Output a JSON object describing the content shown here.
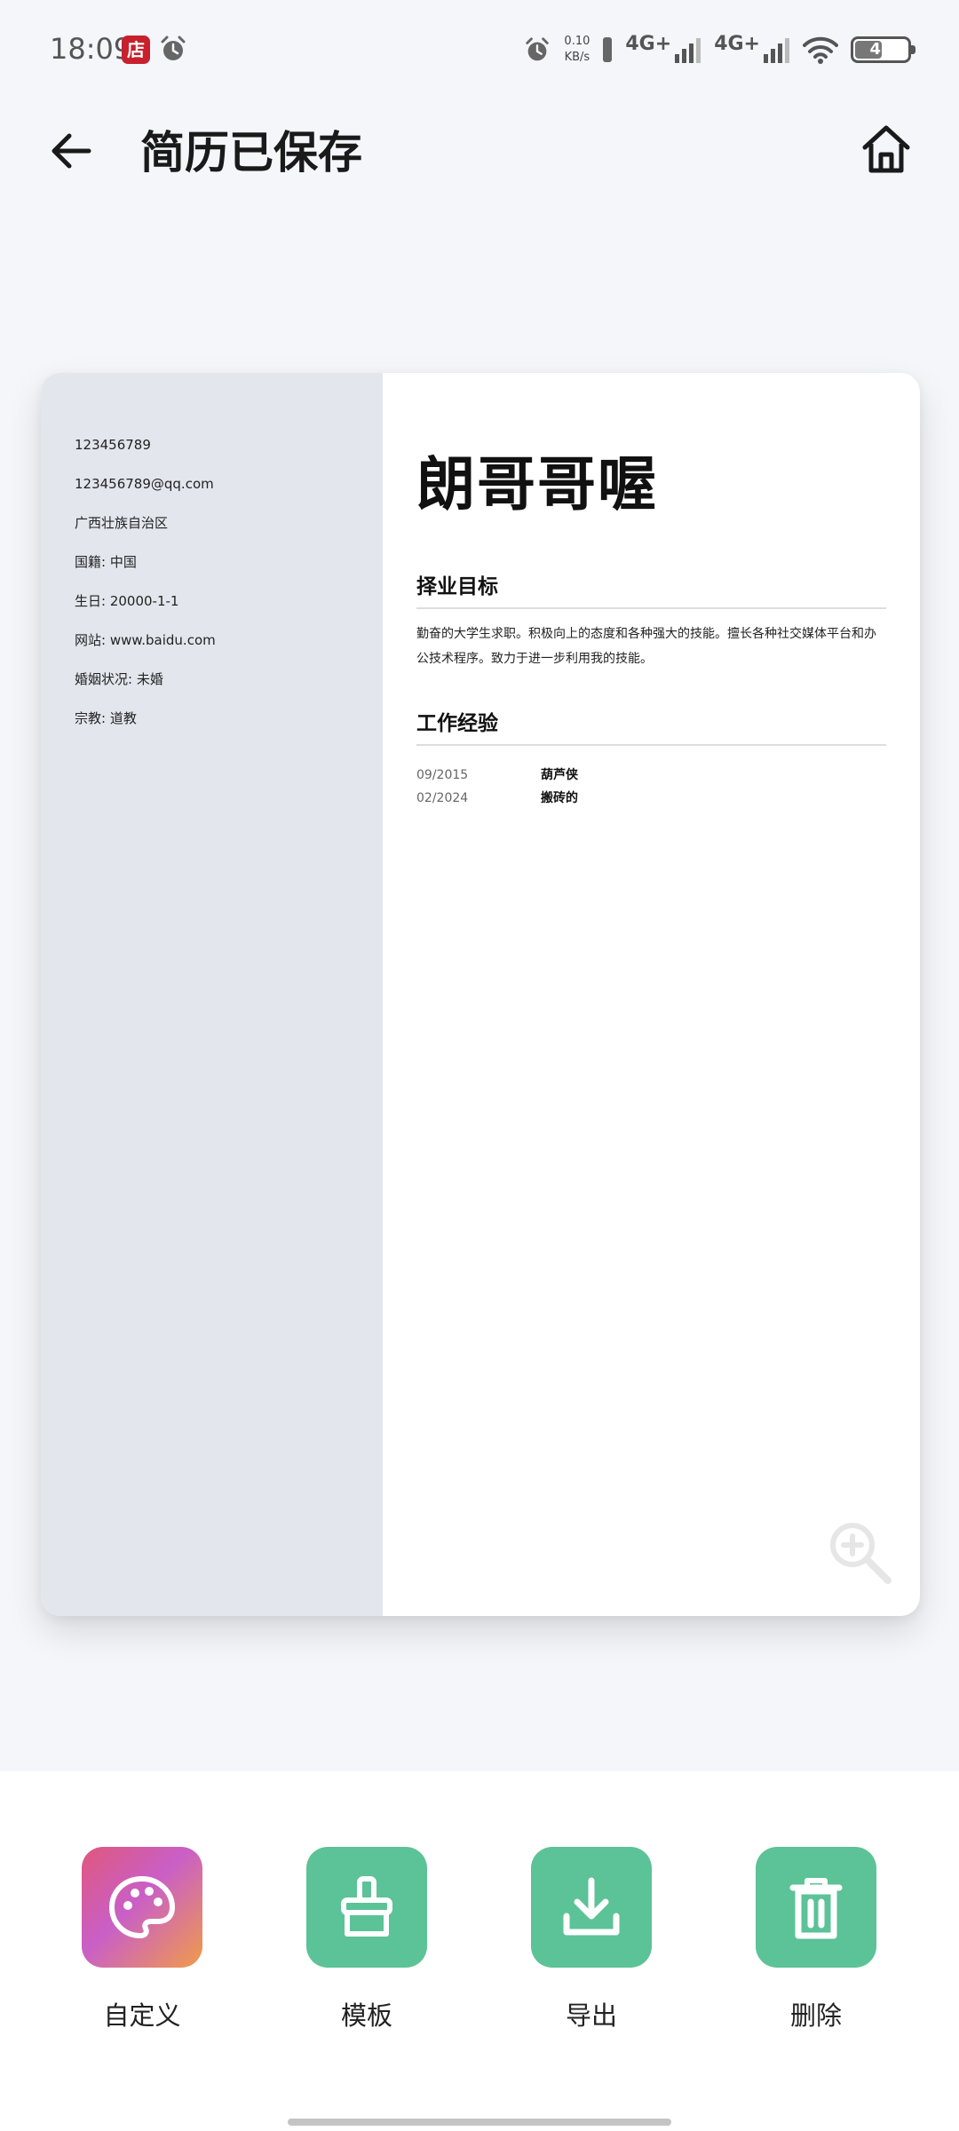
{
  "status_bar": {
    "time": "18:09",
    "app_badge": "店",
    "net_speed_value": "0.10",
    "net_speed_unit": "KB/s",
    "signal_1_label": "4G+",
    "signal_2_label": "4G+",
    "battery_level": "49"
  },
  "header": {
    "title": "简历已保存"
  },
  "resume": {
    "name": "朗哥哥喔",
    "contact_info": [
      "123456789",
      "123456789@qq.com",
      "广西壮族自治区",
      "国籍: 中国",
      "生日: 20000-1-1",
      "网站: www.baidu.com",
      "婚姻状况: 未婚",
      "宗教: 道教"
    ],
    "objective": {
      "title": "择业目标",
      "text": "勤奋的大学生求职。积极向上的态度和各种强大的技能。擅长各种社交媒体平台和办公技术程序。致力于进一步利用我的技能。"
    },
    "experience": {
      "title": "工作经验",
      "rows": [
        {
          "date": "09/2015",
          "desc": "葫芦侠"
        },
        {
          "date": "02/2024",
          "desc": "搬砖的"
        }
      ]
    }
  },
  "actions": [
    {
      "label": "自定义",
      "icon": "palette-icon"
    },
    {
      "label": "模板",
      "icon": "brush-icon"
    },
    {
      "label": "导出",
      "icon": "download-icon"
    },
    {
      "label": "删除",
      "icon": "trash-icon"
    }
  ],
  "colors": {
    "accent_green": "#5cc297",
    "left_column": "#e3e7ed",
    "background": "#f5f6fa"
  }
}
